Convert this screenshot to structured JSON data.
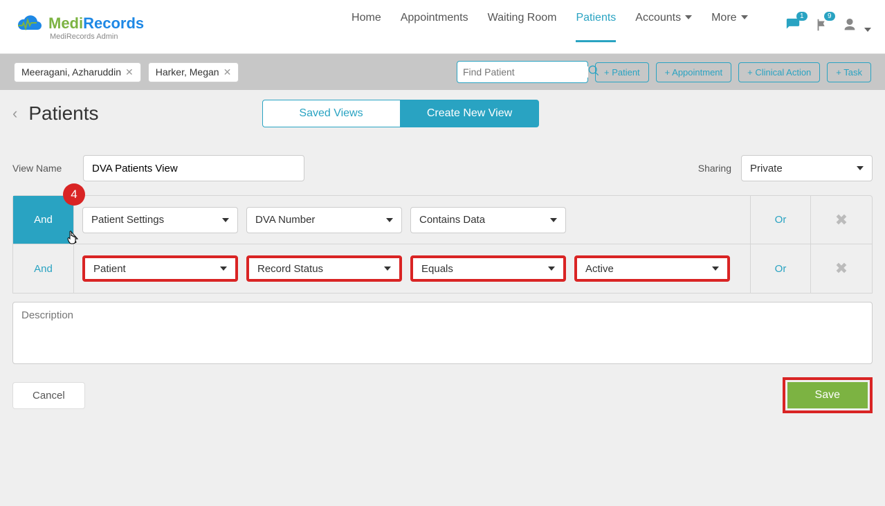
{
  "header": {
    "logo_text_1": "Medi",
    "logo_text_2": "Records",
    "logo_sub": "MediRecords Admin",
    "nav": {
      "home": "Home",
      "appointments": "Appointments",
      "waiting": "Waiting Room",
      "patients": "Patients",
      "accounts": "Accounts",
      "more": "More"
    },
    "badges": {
      "notif": "1",
      "flag": "9"
    }
  },
  "subbar": {
    "chip1": "Meeragani, Azharuddin",
    "chip2": "Harker, Megan",
    "search_placeholder": "Find Patient",
    "add_patient": "+ Patient",
    "add_appointment": "+ Appointment",
    "add_clinical": "+ Clinical Action",
    "add_task": "+ Task"
  },
  "page": {
    "title": "Patients",
    "tab_saved": "Saved Views",
    "tab_create": "Create New View"
  },
  "form": {
    "view_name_label": "View Name",
    "view_name_value": "DVA Patients View",
    "sharing_label": "Sharing",
    "sharing_value": "Private",
    "step_badge": "4",
    "row1": {
      "and": "And",
      "f1": "Patient Settings",
      "f2": "DVA Number",
      "f3": "Contains Data",
      "or": "Or"
    },
    "row2": {
      "and": "And",
      "f1": "Patient",
      "f2": "Record Status",
      "f3": "Equals",
      "f4": "Active",
      "or": "Or"
    },
    "description_placeholder": "Description",
    "cancel": "Cancel",
    "save": "Save"
  }
}
